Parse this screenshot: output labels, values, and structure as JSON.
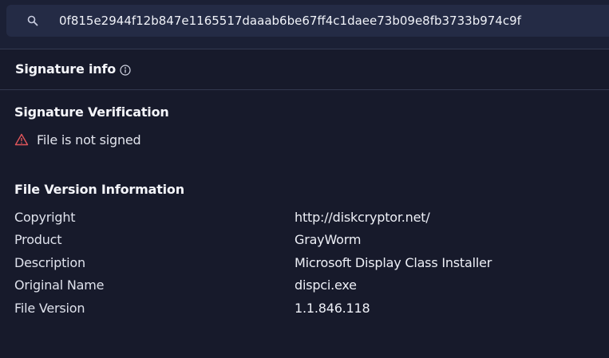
{
  "search": {
    "value": "0f815e2944f12b847e1165517daaab6be67ff4c1daee73b09e8fb3733b974c9f",
    "icon": "search-icon"
  },
  "signature_info": {
    "title": "Signature info",
    "info_icon": "info-icon"
  },
  "verification": {
    "heading": "Signature Verification",
    "status_text": "File is not signed",
    "status_icon": "warning-icon",
    "status_color": "#e0565b"
  },
  "file_version": {
    "heading": "File Version Information",
    "rows": [
      {
        "label": "Copyright",
        "value": "http://diskcryptor.net/"
      },
      {
        "label": "Product",
        "value": "GrayWorm"
      },
      {
        "label": "Description",
        "value": "Microsoft Display Class Installer"
      },
      {
        "label": "Original Name",
        "value": "dispci.exe"
      },
      {
        "label": "File Version",
        "value": "1.1.846.118"
      }
    ]
  }
}
